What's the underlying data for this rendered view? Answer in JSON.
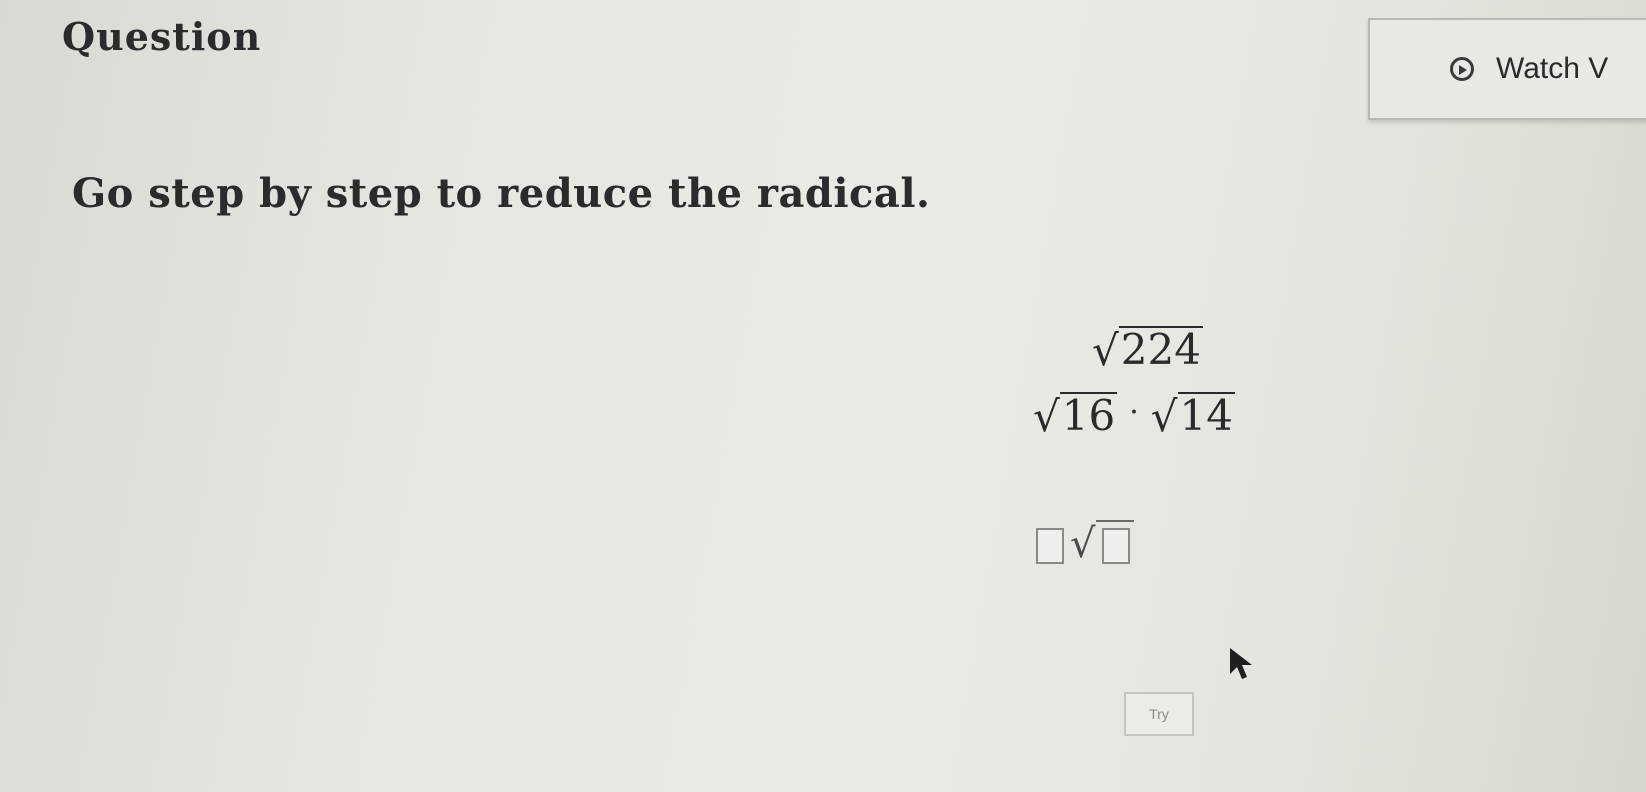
{
  "header": {
    "title": "Question",
    "watch_label": "Watch V"
  },
  "instruction": "Go step by step to reduce the radical.",
  "steps": {
    "step1": {
      "radicand": "224"
    },
    "step2": {
      "left_radicand": "16",
      "operator": "·",
      "right_radicand": "14"
    }
  },
  "answer": {
    "coefficient_value": "",
    "radicand_value": ""
  },
  "try_button": {
    "label": "Try"
  },
  "icons": {
    "watch": "play-circle-icon",
    "cursor": "mouse-pointer-icon"
  }
}
